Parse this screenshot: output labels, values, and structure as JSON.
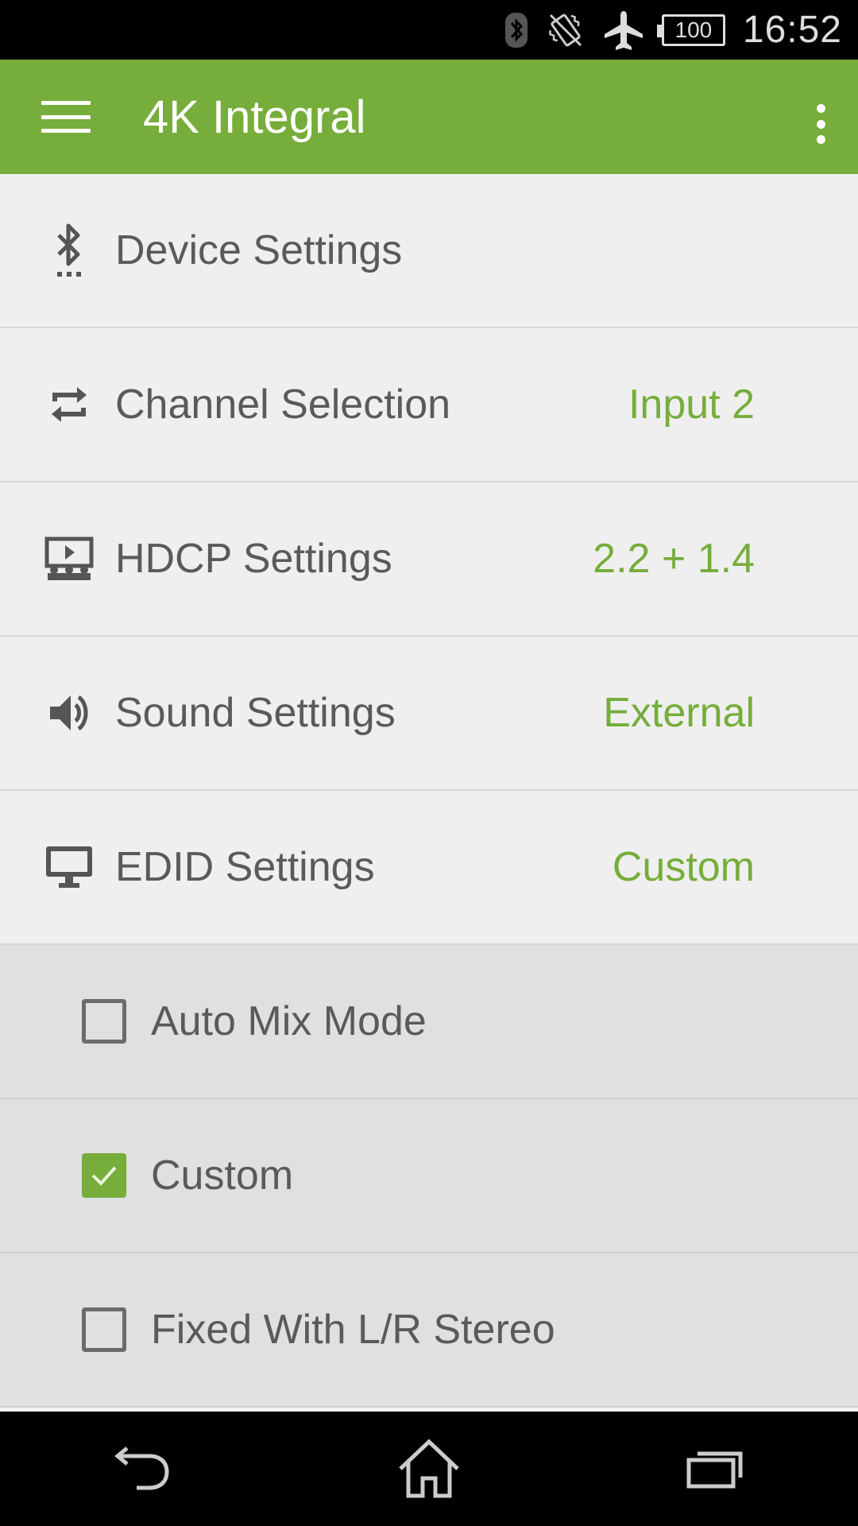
{
  "status_bar": {
    "battery": "100",
    "time": "16:52",
    "icons": [
      "bluetooth-icon",
      "vibrate-icon",
      "airplane-mode-icon",
      "battery-icon"
    ]
  },
  "app_bar": {
    "title": "4K Integral",
    "menu_icon": "hamburger-menu-icon",
    "overflow_icon": "more-vertical-icon"
  },
  "settings": [
    {
      "label": "Device Settings",
      "value": "",
      "icon": "bluetooth-settings-icon"
    },
    {
      "label": "Channel Selection",
      "value": "Input 2",
      "icon": "swap-icon"
    },
    {
      "label": "HDCP Settings",
      "value": "2.2 + 1.4",
      "icon": "presentation-icon"
    },
    {
      "label": "Sound Settings",
      "value": "External",
      "icon": "volume-icon"
    },
    {
      "label": "EDID Settings",
      "value": "Custom",
      "icon": "monitor-icon"
    }
  ],
  "edid_options": [
    {
      "label": "Auto Mix Mode",
      "checked": false
    },
    {
      "label": "Custom",
      "checked": true
    },
    {
      "label": "Fixed With L/R Stereo",
      "checked": false
    }
  ],
  "colors": {
    "accent": "#76ad3b",
    "text": "#5a5a5a",
    "background": "#efefef",
    "sub_background": "#e0e0e0"
  },
  "nav_bar": {
    "icons": [
      "back-icon",
      "home-icon",
      "recents-icon"
    ]
  }
}
